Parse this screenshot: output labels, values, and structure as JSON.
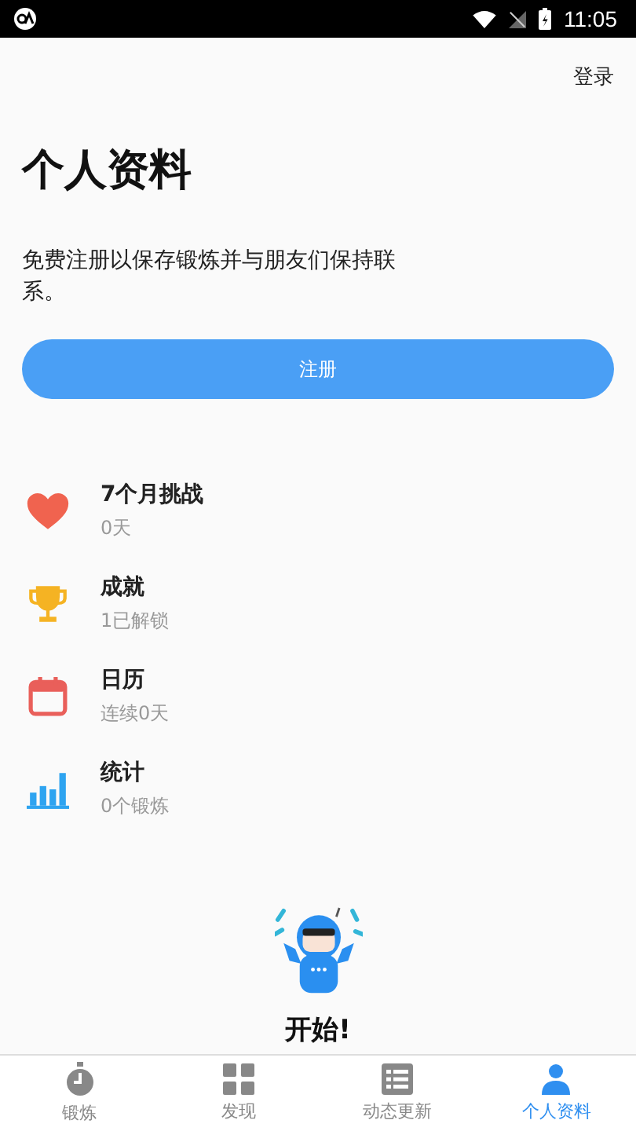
{
  "status_bar": {
    "time": "11:05"
  },
  "login_link": "登录",
  "title": "个人资料",
  "description": "免费注册以保存锻炼并与朋友们保持联系。",
  "register_button": "注册",
  "stats": [
    {
      "kind": "heart",
      "title": "7个月挑战",
      "subtitle": "0天"
    },
    {
      "kind": "trophy",
      "title": "成就",
      "subtitle": "1已解锁"
    },
    {
      "kind": "calendar",
      "title": "日历",
      "subtitle": "连续0天"
    },
    {
      "kind": "chart",
      "title": "统计",
      "subtitle": "0个锻炼"
    }
  ],
  "start_label": "开始!",
  "tabs": [
    {
      "kind": "stopwatch",
      "label": "锻炼",
      "selected": false
    },
    {
      "kind": "grid",
      "label": "发现",
      "selected": false
    },
    {
      "kind": "list",
      "label": "动态更新",
      "selected": false
    },
    {
      "kind": "person",
      "label": "个人资料",
      "selected": true
    }
  ]
}
